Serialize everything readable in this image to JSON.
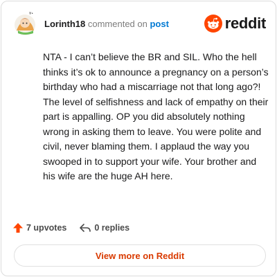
{
  "header": {
    "username": "Lorinth18",
    "commented_on": "commented on",
    "post_link": "post",
    "brand": "reddit"
  },
  "comment": {
    "text": "NTA - I can’t believe the BR and SIL. Who the hell thinks it’s ok to announce a pregnancy on a person’s birthday who had a miscarriage not that long ago?! The level of selfishness and lack of empathy on their part is appalling. OP you did absolutely nothing wrong in asking them to leave. You were polite and civil, never blaming them. I applaud the way you swooped in to support your wife. Your brother and his wife are the huge AH here."
  },
  "actions": {
    "upvotes": "7 upvotes",
    "replies": "0 replies"
  },
  "footer": {
    "view_button": "View more on Reddit"
  },
  "icons": {
    "upvote": "upvote-arrow-icon",
    "reply": "reply-arrow-icon",
    "brand": "reddit-snoo-icon",
    "avatar": "user-avatar"
  },
  "colors": {
    "brand_orange": "#ff4500",
    "link_blue": "#0079d3",
    "button_text": "#d93a00"
  }
}
